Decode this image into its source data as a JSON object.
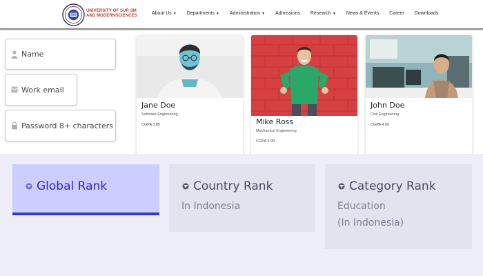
{
  "header": {
    "logo_line1": "UNIVERSITY OF SUR SM",
    "logo_line2": "AND MODERNSCIENCES",
    "nav": [
      {
        "label": "About Us",
        "dropdown": true
      },
      {
        "label": "Departments",
        "dropdown": true
      },
      {
        "label": "Administration",
        "dropdown": true
      },
      {
        "label": "Admissions",
        "dropdown": false
      },
      {
        "label": "Research",
        "dropdown": true
      },
      {
        "label": "News & Events",
        "dropdown": false
      },
      {
        "label": "Career",
        "dropdown": false
      },
      {
        "label": "Downloads",
        "dropdown": false
      }
    ]
  },
  "form": {
    "name_placeholder": "Name",
    "email_placeholder": "Work email",
    "password_placeholder": "Password 8+ characters"
  },
  "students": [
    {
      "name": "Jane Doe",
      "major": "Software Engineering",
      "gpa": "CGPA 3.85"
    },
    {
      "name": "Mike Ross",
      "major": "Mechanical Engineering",
      "gpa": "CGPA 3.90"
    },
    {
      "name": "John Doe",
      "major": "Civil Engineering",
      "gpa": "CGPA 4.00"
    }
  ],
  "ranks": {
    "global": {
      "title": "Global Rank"
    },
    "country": {
      "title": "Country Rank",
      "sub1": "In Indonesia"
    },
    "category": {
      "title": "Category Rank",
      "sub1": "Education",
      "sub2": "(In Indonesia)"
    }
  },
  "colors": {
    "accent": "#3535e0",
    "brand": "#c0392b",
    "rank_bg": "#edeef8"
  }
}
